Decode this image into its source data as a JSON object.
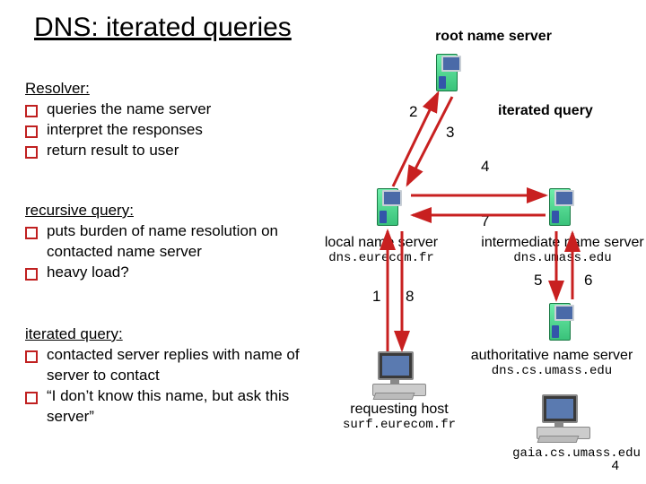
{
  "title": "DNS: iterated queries",
  "resolver": {
    "heading": "Resolver:",
    "b1": "queries the name server",
    "b2": "interpret the responses",
    "b3": "return result to user"
  },
  "recursive": {
    "heading": "recursive query:",
    "b1": "puts burden of name resolution on contacted name server",
    "b2": "heavy load?"
  },
  "iterated": {
    "heading": "iterated query:",
    "b1": "contacted server replies with name of server to contact",
    "b2": "“I don’t know this name, but ask this server”"
  },
  "labels": {
    "root": "root name server",
    "iterq": "iterated query",
    "local_title": "local name server",
    "local_host": "dns.eurecom.fr",
    "inter_title": "intermediate name server",
    "inter_host": "dns.umass.edu",
    "auth_title": "authoritative name server",
    "auth_host": "dns.cs.umass.edu",
    "req_title": "requesting host",
    "req_host": "surf.eurecom.fr",
    "gaia": "gaia.cs.umass.edu"
  },
  "nums": {
    "n1": "1",
    "n2": "2",
    "n3": "3",
    "n4": "4",
    "n5": "5",
    "n6": "6",
    "n7": "7",
    "n8": "8"
  },
  "page": "4"
}
